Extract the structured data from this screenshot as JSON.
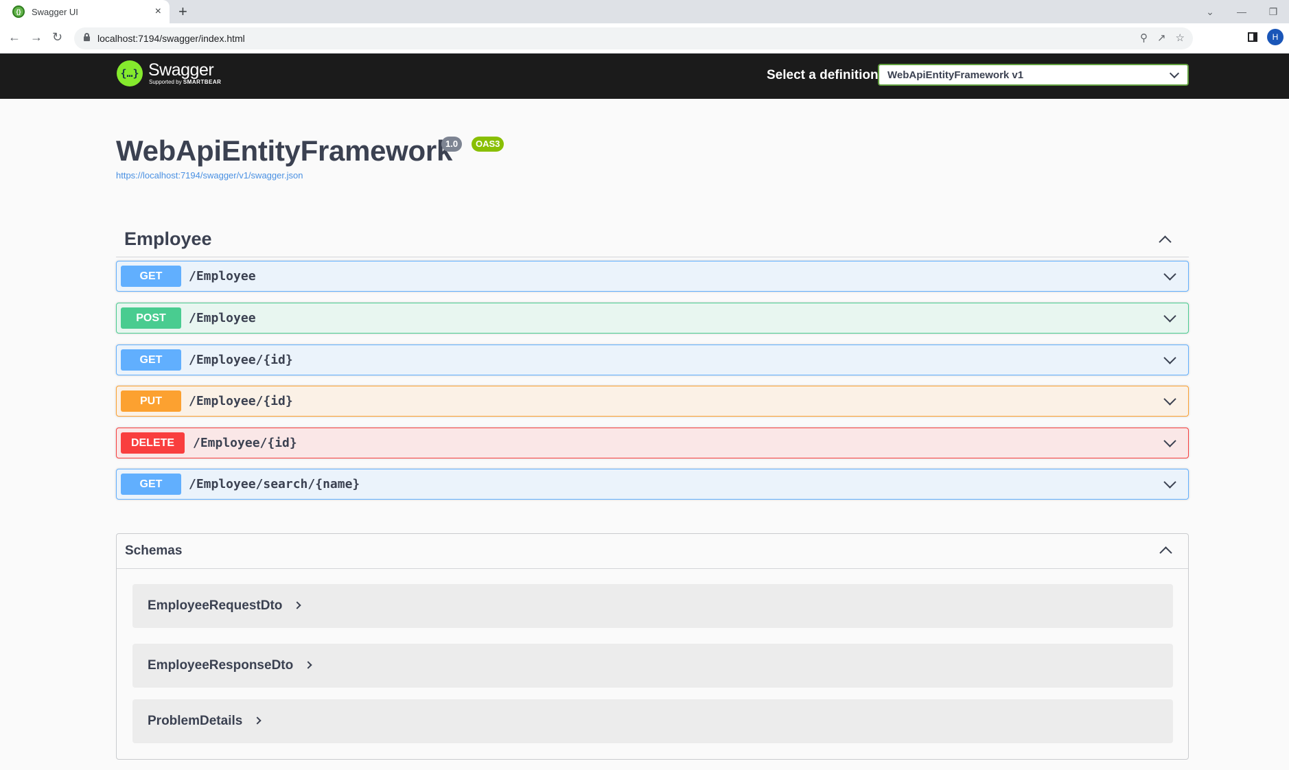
{
  "browser": {
    "tab_title": "Swagger UI",
    "tab_close": "×",
    "new_tab": "+",
    "url": "localhost:7194/swagger/index.html",
    "profile_initial": "H",
    "window_controls": [
      "⌄",
      "—",
      "❐"
    ]
  },
  "topbar": {
    "logo_name": "Swagger",
    "logo_sub_prefix": "Supported by",
    "logo_sub_brand": "SMARTBEAR",
    "definition_label": "Select a definition",
    "definition_value": "WebApiEntityFramework v1"
  },
  "info": {
    "title": "WebApiEntityFramework",
    "version": "1.0",
    "oas_badge": "OAS3",
    "spec_url": "https://localhost:7194/swagger/v1/swagger.json"
  },
  "tag": {
    "name": "Employee"
  },
  "operations": [
    {
      "method": "GET",
      "path": "/Employee",
      "color": "#61affe"
    },
    {
      "method": "POST",
      "path": "/Employee",
      "color": "#49cc90"
    },
    {
      "method": "GET",
      "path": "/Employee/{id}",
      "color": "#61affe"
    },
    {
      "method": "PUT",
      "path": "/Employee/{id}",
      "color": "#fca130"
    },
    {
      "method": "DELETE",
      "path": "/Employee/{id}",
      "color": "#f93e3e"
    },
    {
      "method": "GET",
      "path": "/Employee/search/{name}",
      "color": "#61affe"
    }
  ],
  "schemas": {
    "title": "Schemas",
    "models": [
      {
        "name": "EmployeeRequestDto"
      },
      {
        "name": "EmployeeResponseDto"
      },
      {
        "name": "ProblemDetails"
      }
    ]
  }
}
